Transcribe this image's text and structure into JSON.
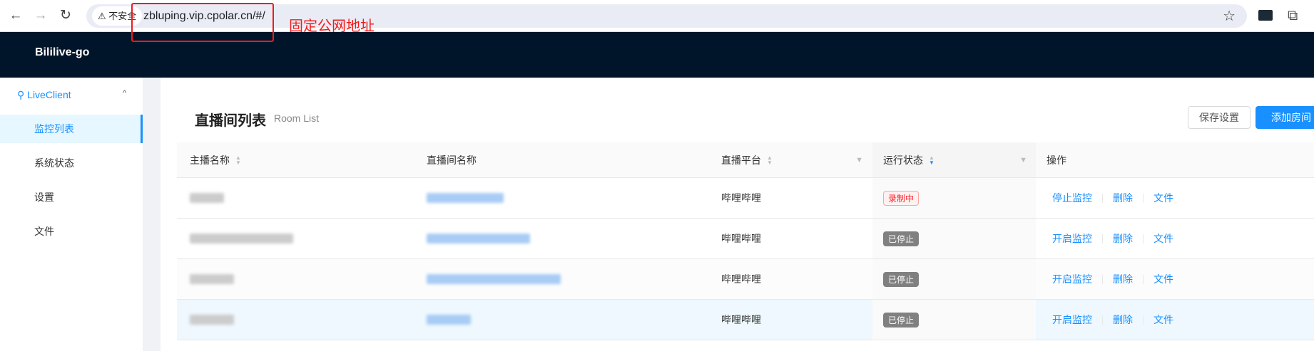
{
  "browser": {
    "insecure_label": "不安全",
    "url": "zbluping.vip.cpolar.cn/#/",
    "annotation": "固定公网地址"
  },
  "app": {
    "brand": "Bililive-go"
  },
  "sidebar": {
    "group": "LiveClient",
    "items": [
      {
        "label": "监控列表",
        "active": true
      },
      {
        "label": "系统状态"
      },
      {
        "label": "设置"
      },
      {
        "label": "文件"
      }
    ]
  },
  "page": {
    "title": "直播间列表",
    "subtitle": "Room List",
    "save_label": "保存设置",
    "add_label": "添加房间"
  },
  "table": {
    "columns": [
      "主播名称",
      "直播间名称",
      "直播平台",
      "运行状态",
      "操作"
    ],
    "rows": [
      {
        "platform": "哔哩哔哩",
        "status": "录制中",
        "recording": true,
        "actions": [
          "停止监控",
          "删除",
          "文件"
        ]
      },
      {
        "platform": "哔哩哔哩",
        "status": "已停止",
        "recording": false,
        "actions": [
          "开启监控",
          "删除",
          "文件"
        ]
      },
      {
        "platform": "哔哩哔哩",
        "status": "已停止",
        "recording": false,
        "actions": [
          "开启监控",
          "删除",
          "文件"
        ]
      },
      {
        "platform": "哔哩哔哩",
        "status": "已停止",
        "recording": false,
        "actions": [
          "开启监控",
          "删除",
          "文件"
        ]
      }
    ]
  },
  "colors": {
    "accent": "#1890ff",
    "header": "#001529",
    "annotation": "#f21b1b"
  }
}
